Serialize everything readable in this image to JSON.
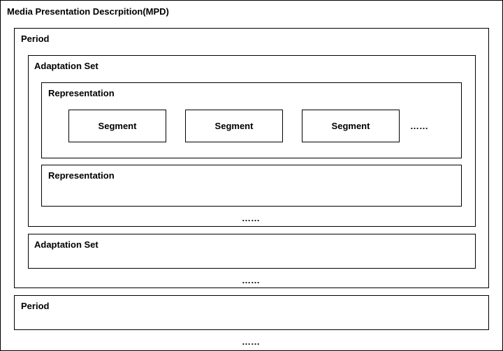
{
  "mpd": {
    "title": "Media Presentation Descrpition(MPD)"
  },
  "period1": {
    "label": "Period"
  },
  "adaptation_set1": {
    "label": "Adaptation Set"
  },
  "representation1": {
    "label": "Representation",
    "segments": [
      "Segment",
      "Segment",
      "Segment"
    ],
    "more": "……"
  },
  "representation2": {
    "label": "Representation"
  },
  "adaptation_more": "……",
  "adaptation_set2": {
    "label": "Adaptation Set"
  },
  "period_more": "……",
  "period2": {
    "label": "Period"
  },
  "mpd_more": "……"
}
